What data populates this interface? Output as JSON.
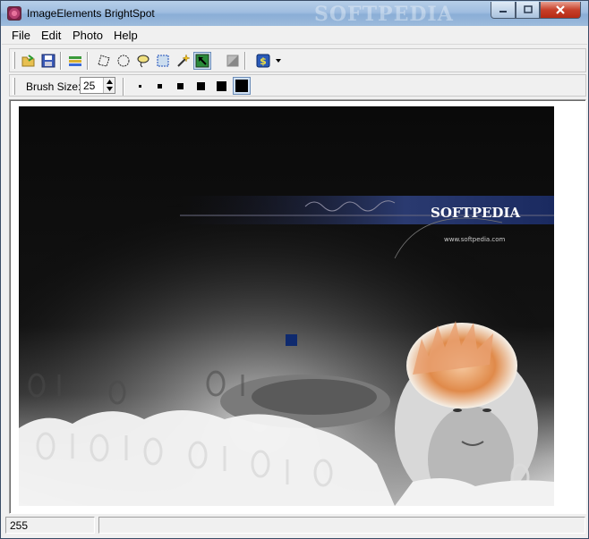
{
  "window": {
    "title": "ImageElements BrightSpot",
    "title_watermark": "SOFTPEDIA"
  },
  "menu": [
    "File",
    "Edit",
    "Photo",
    "Help"
  ],
  "toolbar": {
    "brush_size_label": "Brush Size:",
    "brush_size_value": "25"
  },
  "image": {
    "brand": "SOFTPEDIA",
    "url": "www.softpedia.com"
  },
  "status": {
    "value": "255"
  },
  "colors": {
    "titlebar": "#9fbde0",
    "canvas_bg": "#ffffff",
    "photo_dark": "#0a0a0a",
    "selection_marker": "#0f2a6e"
  }
}
